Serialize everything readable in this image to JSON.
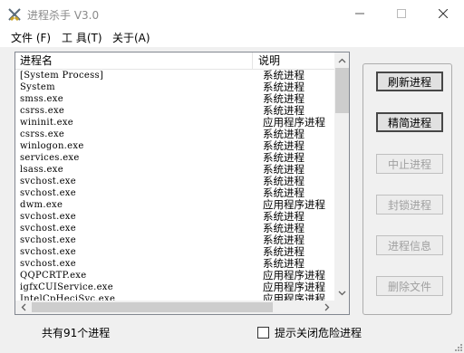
{
  "window": {
    "title": "进程杀手 V3.0",
    "app_icon": "crossed-swords-icon"
  },
  "menu": {
    "file": "文件 (F)",
    "tools": "工 具(T)",
    "about": "关于(A)"
  },
  "list": {
    "headers": {
      "name": "进程名",
      "desc": "说明"
    },
    "rows": [
      {
        "name": "[System Process]",
        "desc": "系统进程"
      },
      {
        "name": "System",
        "desc": "系统进程"
      },
      {
        "name": "smss.exe",
        "desc": "系统进程"
      },
      {
        "name": "csrss.exe",
        "desc": "系统进程"
      },
      {
        "name": "wininit.exe",
        "desc": "应用程序进程"
      },
      {
        "name": "csrss.exe",
        "desc": "系统进程"
      },
      {
        "name": "winlogon.exe",
        "desc": "系统进程"
      },
      {
        "name": "services.exe",
        "desc": "系统进程"
      },
      {
        "name": "lsass.exe",
        "desc": "系统进程"
      },
      {
        "name": "svchost.exe",
        "desc": "系统进程"
      },
      {
        "name": "svchost.exe",
        "desc": "系统进程"
      },
      {
        "name": "dwm.exe",
        "desc": "应用程序进程"
      },
      {
        "name": "svchost.exe",
        "desc": "系统进程"
      },
      {
        "name": "svchost.exe",
        "desc": "系统进程"
      },
      {
        "name": "svchost.exe",
        "desc": "系统进程"
      },
      {
        "name": "svchost.exe",
        "desc": "系统进程"
      },
      {
        "name": "svchost.exe",
        "desc": "系统进程"
      },
      {
        "name": "QQPCRTP.exe",
        "desc": "应用程序进程"
      },
      {
        "name": "igfxCUIService.exe",
        "desc": "应用程序进程"
      },
      {
        "name": "IntelCpHeciSvc.exe",
        "desc": "应用程序进程"
      }
    ]
  },
  "buttons": {
    "refresh": "刷新进程",
    "simplify": "精简进程",
    "terminate": "中止进程",
    "lock": "封锁进程",
    "info": "进程信息",
    "delete": "删除文件"
  },
  "status": {
    "count_text": "共有91个进程",
    "danger_checkbox_label": "提示关闭危险进程",
    "danger_checkbox_checked": false
  }
}
